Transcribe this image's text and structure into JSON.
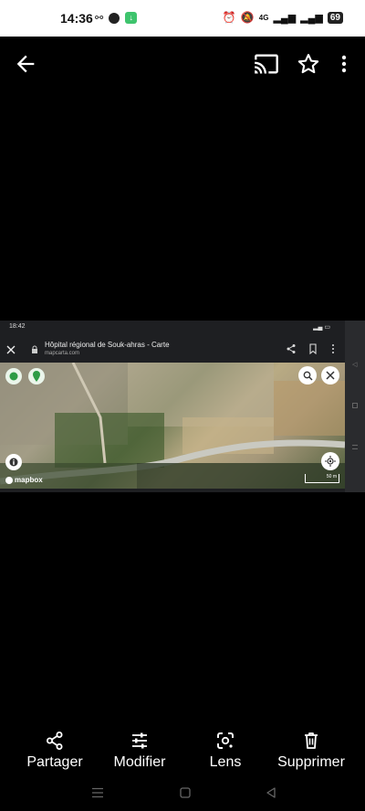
{
  "status_bar": {
    "time": "14:36",
    "network": "4G",
    "battery": "69"
  },
  "top_bar": {
    "icons": [
      "back-arrow-icon",
      "cast-icon",
      "star-icon",
      "more-vert-icon"
    ]
  },
  "embedded_screenshot": {
    "status_time": "18:42",
    "page_title": "Hôpital régional de Souk-ahras - Carte",
    "page_url": "mapcarta.com",
    "map_attribution": "mapbox",
    "scale_label": "50 m"
  },
  "actions": [
    {
      "label": "Partager",
      "icon": "share-icon"
    },
    {
      "label": "Modifier",
      "icon": "tune-icon"
    },
    {
      "label": "Lens",
      "icon": "lens-icon"
    },
    {
      "label": "Supprimer",
      "icon": "trash-icon"
    }
  ],
  "colors": {
    "background": "#000000",
    "status_bar": "#ffffff",
    "badge_green": "#3ec46d"
  }
}
